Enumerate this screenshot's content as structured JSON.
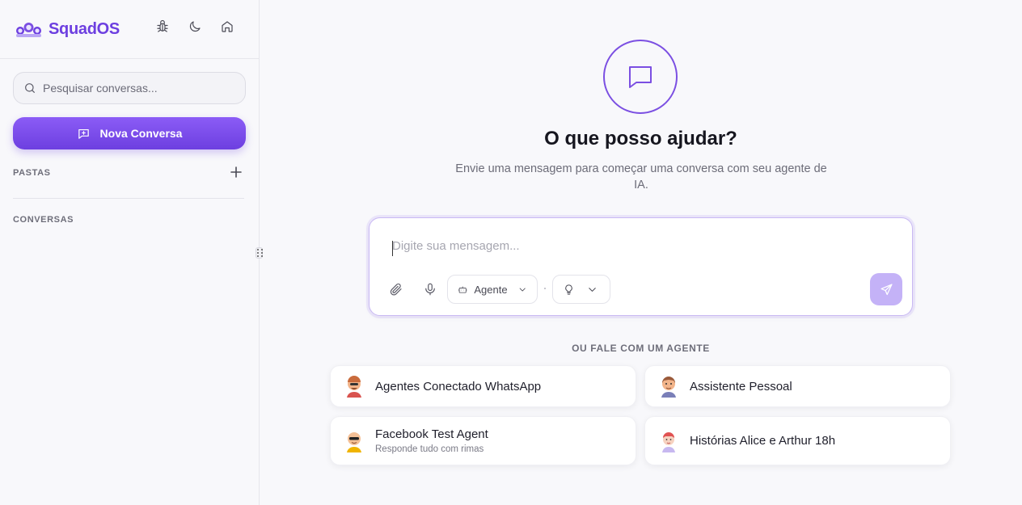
{
  "app": {
    "name": "SquadOS",
    "brand_color": "#6d3fe0"
  },
  "header": {
    "icons": [
      "bug-icon",
      "moon-icon",
      "home-icon"
    ]
  },
  "sidebar": {
    "search_placeholder": "Pesquisar conversas...",
    "new_conversation_label": "Nova Conversa",
    "folders_label": "PASTAS",
    "conversations_label": "CONVERSAS"
  },
  "main": {
    "title": "O que posso ajudar?",
    "subtitle": "Envie uma mensagem para começar uma conversa com seu agente de IA.",
    "composer": {
      "placeholder": "Digite sua mensagem...",
      "agent_selector_label": "Agente"
    },
    "agents_heading": "OU FALE COM UM AGENTE",
    "agents": [
      {
        "name": "Agentes Conectado WhatsApp",
        "description": ""
      },
      {
        "name": "Assistente Pessoal",
        "description": ""
      },
      {
        "name": "Facebook Test Agent",
        "description": "Responde tudo com rimas"
      },
      {
        "name": "Histórias Alice e Arthur 18h",
        "description": ""
      }
    ]
  }
}
